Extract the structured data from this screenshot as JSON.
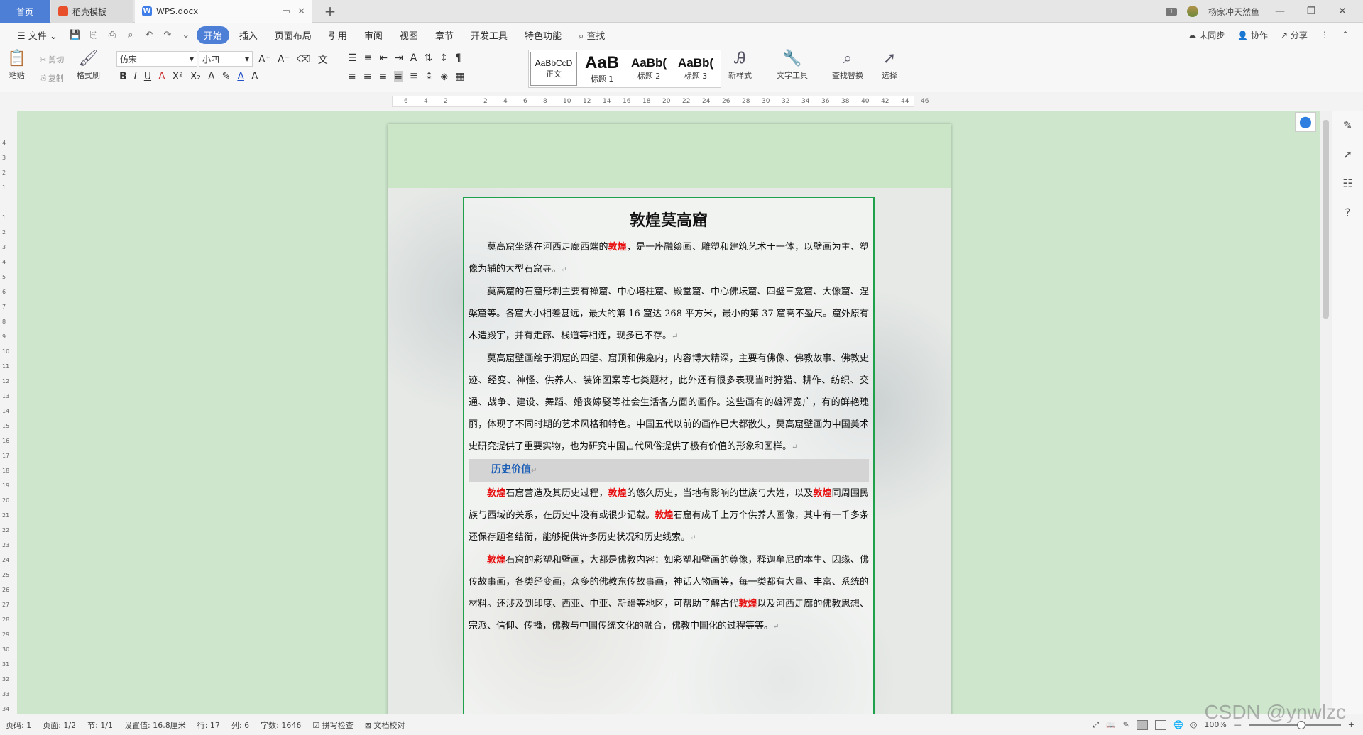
{
  "tabs": {
    "home": "首页",
    "template": "稻壳模板",
    "doc": "WPS.docx",
    "add": "+"
  },
  "window": {
    "badge": "1",
    "user": "杨家冲天然鱼",
    "minimize": "—",
    "restore": "❐",
    "close": "✕"
  },
  "menu": {
    "file": "文件",
    "items": [
      "开始",
      "插入",
      "页面布局",
      "引用",
      "审阅",
      "视图",
      "章节",
      "开发工具",
      "特色功能"
    ],
    "search": "查找",
    "sync": "未同步",
    "collab": "协作",
    "share": "分享"
  },
  "ribbon": {
    "paste": "粘贴",
    "cut": "剪切",
    "copy": "复制",
    "format_painter": "格式刷",
    "font_name": "仿宋",
    "font_size": "小四",
    "styles": [
      {
        "sample": "AaBbCcD",
        "label": "正文"
      },
      {
        "sample": "AaB",
        "label": "标题 1"
      },
      {
        "sample": "AaBb(",
        "label": "标题 2"
      },
      {
        "sample": "AaBb(",
        "label": "标题 3"
      }
    ],
    "new_style": "新样式",
    "text_tools": "文字工具",
    "find_replace": "查找替换",
    "select": "选择"
  },
  "ruler": {
    "ticks": [
      "6",
      "4",
      "2",
      "",
      "2",
      "4",
      "6",
      "8",
      "10",
      "12",
      "14",
      "16",
      "18",
      "20",
      "22",
      "24",
      "26",
      "28",
      "30",
      "32",
      "34",
      "36",
      "38",
      "40",
      "42",
      "44",
      "46"
    ],
    "left_ticks": [
      "4",
      "3",
      "2",
      "1",
      "",
      "1",
      "2",
      "3",
      "4",
      "5",
      "6",
      "7",
      "8",
      "9",
      "10",
      "11",
      "12",
      "13",
      "14",
      "15",
      "16",
      "17",
      "18",
      "19",
      "20",
      "21",
      "22",
      "23",
      "24",
      "25",
      "26",
      "27",
      "28",
      "29",
      "30",
      "31",
      "32",
      "33",
      "34"
    ]
  },
  "document": {
    "title": "敦煌莫高窟",
    "p1": {
      "a": "莫高窟坐落在河西走廊西端的",
      "hl": "敦煌",
      "b": "，是一座融绘画、雕塑和建筑艺术于一体，以壁画为主、塑像为辅的大型石窟寺。"
    },
    "p2": "莫高窟的石窟形制主要有禅窟、中心塔柱窟、殿堂窟、中心佛坛窟、四壁三龛窟、大像窟、涅槃窟等。各窟大小相差甚远，最大的第 16 窟达 268 平方米，最小的第 37 窟高不盈尺。窟外原有木造殿宇，并有走廊、栈道等相连，现多已不存。",
    "p3": "莫高窟壁画绘于洞窟的四壁、窟顶和佛龛内，内容博大精深，主要有佛像、佛教故事、佛教史迹、经变、神怪、供养人、装饰图案等七类题材，此外还有很多表现当时狩猎、耕作、纺织、交通、战争、建设、舞蹈、婚丧嫁娶等社会生活各方面的画作。这些画有的雄浑宽广，有的鲜艳瑰丽，体现了不同时期的艺术风格和特色。中国五代以前的画作已大都散失，莫高窟壁画为中国美术史研究提供了重要实物，也为研究中国古代风俗提供了极有价值的形象和图样。",
    "heading": "历史价值",
    "p4": {
      "hl1": "敦煌",
      "a": "石窟营造及其历史过程，",
      "hl2": "敦煌",
      "b": "的悠久历史，当地有影响的世族与大姓，以及",
      "hl3": "敦煌",
      "c": "同周围民族与西域的关系，在历史中没有或很少记载。",
      "hl4": "敦煌",
      "d": "石窟有成千上万个供养人画像，其中有一千多条还保存题名结衔，能够提供许多历史状况和历史线索。"
    },
    "p5": {
      "hl1": "敦煌",
      "a": "石窟的彩塑和壁画，大都是佛教内容：如彩塑和壁画的尊像，释迦牟尼的本生、因缘、佛传故事画，各类经变画，众多的佛教东传故事画，神话人物画等，每一类都有大量、丰富、系统的材料。还涉及到印度、西亚、中亚、新疆等地区，可帮助了解古代",
      "hl2": "敦煌",
      "b": "以及河西走廊的佛教思想、宗派、信仰、传播，佛教与中国传统文化的融合，佛教中国化的过程等等。"
    },
    "para_mark": "↵"
  },
  "status": {
    "page_code": "页码: 1",
    "page": "页面: 1/2",
    "section": "节: 1/1",
    "setting": "设置值: 16.8厘米",
    "row": "行: 17",
    "col": "列: 6",
    "word_count": "字数: 1646",
    "spell_check": "拼写检查",
    "doc_check": "文档校对",
    "zoom": "100%"
  },
  "watermark": "CSDN @ynwlzc",
  "colors": {
    "accent": "#4e7fd6",
    "highlight": "#e81010",
    "heading": "#1d5fb7",
    "frame": "#1ea14a",
    "canvas": "#cde6cc"
  }
}
